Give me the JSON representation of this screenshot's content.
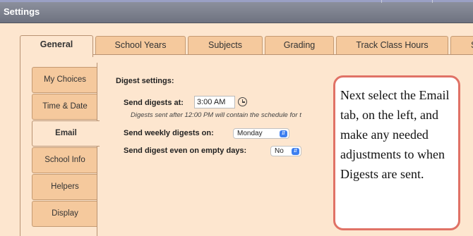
{
  "window": {
    "title": "Settings"
  },
  "top_tabs": [
    {
      "label": "General",
      "active": true
    },
    {
      "label": "School Years",
      "active": false
    },
    {
      "label": "Subjects",
      "active": false
    },
    {
      "label": "Grading",
      "active": false
    },
    {
      "label": "Track Class Hours",
      "active": false
    },
    {
      "label": "S",
      "active": false
    }
  ],
  "side_tabs": [
    {
      "label": "My Choices",
      "active": false
    },
    {
      "label": "Time & Date",
      "active": false
    },
    {
      "label": "Email",
      "active": true
    },
    {
      "label": "School Info",
      "active": false
    },
    {
      "label": "Helpers",
      "active": false
    },
    {
      "label": "Display",
      "active": false
    }
  ],
  "digest": {
    "section_title": "Digest settings:",
    "send_at_label": "Send digests at:",
    "send_at_value": "3:00 AM",
    "note": "Digests sent after 12:00 PM will contain the schedule for t",
    "weekly_label": "Send weekly digests on:",
    "weekly_value": "Monday",
    "empty_days_label": "Send digest even on empty days:",
    "empty_days_value": "No"
  },
  "callout": {
    "text": "Next select the Email tab, on the left, and make any needed adjustments to when Digests are sent."
  },
  "colors": {
    "background": "#fde6cf",
    "tab": "#f5c99d",
    "titlebar": "#7a7e8b",
    "callout_border": "#e07266",
    "select_chevron": "#3d7ff0"
  },
  "icons": {
    "time_picker": "clock-icon",
    "select": "chevron-updown-icon"
  }
}
